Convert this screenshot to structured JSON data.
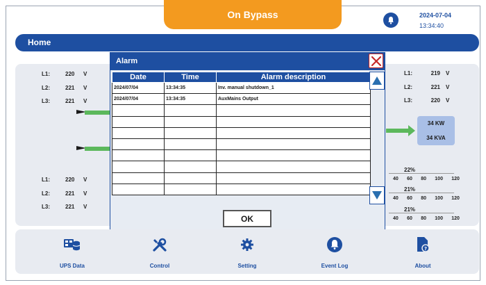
{
  "header": {
    "status": "On Bypass",
    "date": "2024-07-04",
    "time": "13:34:40"
  },
  "home_label": "Home",
  "input_top": [
    {
      "label": "L1:",
      "value": "220",
      "unit": "V"
    },
    {
      "label": "L2:",
      "value": "221",
      "unit": "V"
    },
    {
      "label": "L3:",
      "value": "221",
      "unit": "V"
    }
  ],
  "input_bottom": [
    {
      "label": "L1:",
      "value": "220",
      "unit": "V"
    },
    {
      "label": "L2:",
      "value": "221",
      "unit": "V"
    },
    {
      "label": "L3:",
      "value": "221",
      "unit": "V"
    }
  ],
  "output": [
    {
      "label": "L1:",
      "value": "219",
      "unit": "V"
    },
    {
      "label": "L2:",
      "value": "221",
      "unit": "V"
    },
    {
      "label": "L3:",
      "value": "220",
      "unit": "V"
    }
  ],
  "power": {
    "kw": "34 KW",
    "kva": "34 KVA"
  },
  "loads": [
    {
      "percent": "22%",
      "scale": [
        "40",
        "60",
        "80",
        "100",
        "120"
      ]
    },
    {
      "percent": "21%",
      "scale": [
        "40",
        "60",
        "80",
        "100",
        "120"
      ]
    },
    {
      "percent": "21%",
      "scale": [
        "40",
        "60",
        "80",
        "100",
        "120"
      ]
    }
  ],
  "alarm": {
    "title": "Alarm",
    "headers": {
      "date": "Date",
      "time": "Time",
      "desc": "Alarm description"
    },
    "rows": [
      {
        "date": "2024/07/04",
        "time": "13:34:35",
        "desc": "Inv. manual shutdown_1"
      },
      {
        "date": "2024/07/04",
        "time": "13:34:35",
        "desc": "AuxMains Output"
      },
      {
        "date": "",
        "time": "",
        "desc": ""
      },
      {
        "date": "",
        "time": "",
        "desc": ""
      },
      {
        "date": "",
        "time": "",
        "desc": ""
      },
      {
        "date": "",
        "time": "",
        "desc": ""
      },
      {
        "date": "",
        "time": "",
        "desc": ""
      },
      {
        "date": "",
        "time": "",
        "desc": ""
      },
      {
        "date": "",
        "time": "",
        "desc": ""
      },
      {
        "date": "",
        "time": "",
        "desc": ""
      }
    ],
    "ok_label": "OK"
  },
  "nav": [
    {
      "label": "UPS Data",
      "icon": "ups-data-icon"
    },
    {
      "label": "Control",
      "icon": "tools-icon"
    },
    {
      "label": "Setting",
      "icon": "gear-icon"
    },
    {
      "label": "Event Log",
      "icon": "bell-icon"
    },
    {
      "label": "About",
      "icon": "document-info-icon"
    }
  ],
  "colors": {
    "primary": "#1e4fa1",
    "accent": "#f39a1f",
    "power_flow": "#5cb85c",
    "close": "#c62828"
  }
}
